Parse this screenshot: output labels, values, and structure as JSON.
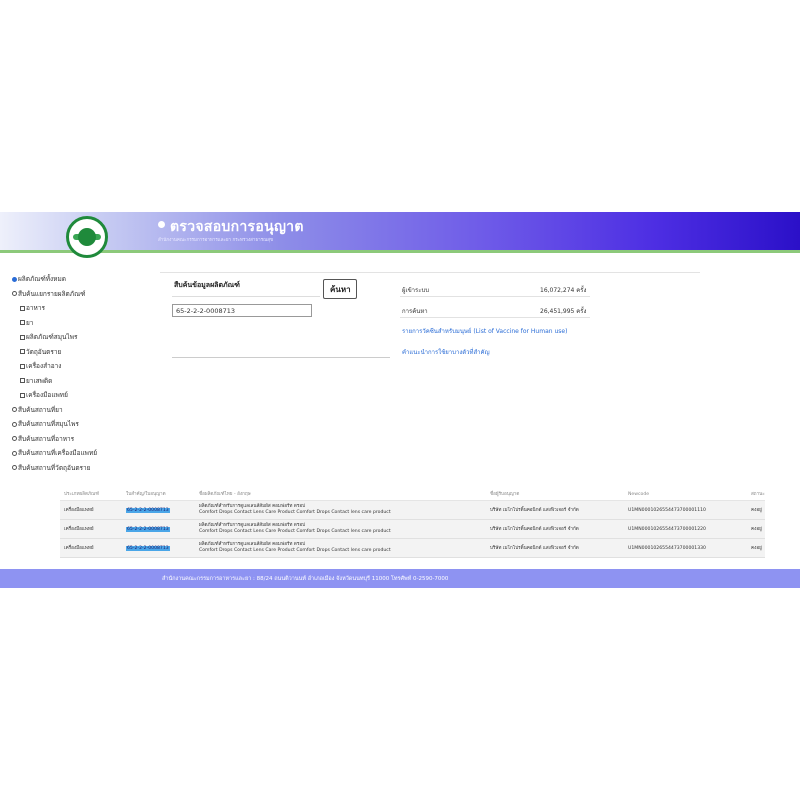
{
  "header": {
    "title": "ตรวจสอบการอนุญาต",
    "subtitle": "สำนักงานคณะกรรมการอาหารและยา กระทรวงสาธารณสุข"
  },
  "sidebar": {
    "items": [
      {
        "type": "radio",
        "checked": true,
        "label": "ผลิตภัณฑ์ทั้งหมด",
        "indent": false
      },
      {
        "type": "radio",
        "checked": false,
        "label": "สืบค้นแยกรายผลิตภัณฑ์",
        "indent": false
      },
      {
        "type": "checkbox",
        "checked": false,
        "label": "อาหาร",
        "indent": true
      },
      {
        "type": "checkbox",
        "checked": false,
        "label": "ยา",
        "indent": true
      },
      {
        "type": "checkbox",
        "checked": false,
        "label": "ผลิตภัณฑ์สมุนไพร",
        "indent": true
      },
      {
        "type": "checkbox",
        "checked": false,
        "label": "วัตถุอันตราย",
        "indent": true
      },
      {
        "type": "checkbox",
        "checked": false,
        "label": "เครื่องสำอาง",
        "indent": true
      },
      {
        "type": "checkbox",
        "checked": false,
        "label": "ยาเสพติด",
        "indent": true
      },
      {
        "type": "checkbox",
        "checked": false,
        "label": "เครื่องมือแพทย์",
        "indent": true
      },
      {
        "type": "radio",
        "checked": false,
        "label": "สืบค้นสถานที่ยา",
        "indent": false
      },
      {
        "type": "radio",
        "checked": false,
        "label": "สืบค้นสถานที่สมุนไพร",
        "indent": false
      },
      {
        "type": "radio",
        "checked": false,
        "label": "สืบค้นสถานที่อาหาร",
        "indent": false
      },
      {
        "type": "radio",
        "checked": false,
        "label": "สืบค้นสถานที่เครื่องมือแพทย์",
        "indent": false
      },
      {
        "type": "radio",
        "checked": false,
        "label": "สืบค้นสถานที่วัตถุอันตราย",
        "indent": false
      }
    ]
  },
  "search": {
    "label": "สืบค้นข้อมูลผลิตภัณฑ์",
    "button": "ค้นหา",
    "value": "65-2-2-2-0008713"
  },
  "stats": {
    "visitors_label": "ผู้เข้าระบบ",
    "visitors_value": "16,072,274 ครั้ง",
    "searches_label": "การค้นหา",
    "searches_value": "26,451,995 ครั้ง"
  },
  "links": {
    "vaccine": "รายการวัคซีนสำหรับมนุษย์ (List of Vaccine for Human use)",
    "essential": "คำแนะนำการใช้ยาบางตัวที่สำคัญ"
  },
  "table": {
    "headers": [
      "ประเภทผลิตภัณฑ์",
      "ใบสำคัญ/ใบอนุญาต",
      "ชื่อผลิตภัณฑ์ไทย - อังกฤษ",
      "ชื่อผู้รับอนุญาต",
      "Newcode",
      "สถานะ"
    ],
    "rows": [
      {
        "type": "เครื่องมือแพทย์",
        "license": "65-2-2-2-0008713",
        "name_th": "ผลิตภัณฑ์สำหรับการดูแลเลนส์สัมผัส คอมฟอร์ท ดรอป",
        "name_en": "Comfort Drops Contact Lens Care Product Comfort Drops Contact lens care product",
        "company": "บริษัท เมโกโปรดิ้นคอนิกด์ แสงฟิวเจอร์ จำกัด",
        "newcode": "U1MN0001026554473700001110",
        "status": "คงอยู่"
      },
      {
        "type": "เครื่องมือแพทย์",
        "license": "65-2-2-2-0008713",
        "name_th": "ผลิตภัณฑ์สำหรับการดูแลเลนส์สัมผัส คอมฟอร์ท ดรอป",
        "name_en": "Comfort Drops Contact Lens Care Product Comfort Drops Contact lens care product",
        "company": "บริษัท เมโกโปรดิ้นคอนิกด์ แสงฟิวเจอร์ จำกัด",
        "newcode": "U1MN0001026554473700001220",
        "status": "คงอยู่"
      },
      {
        "type": "เครื่องมือแพทย์",
        "license": "65-2-2-2-0008713",
        "name_th": "ผลิตภัณฑ์สำหรับการดูแลเลนส์สัมผัส คอมฟอร์ท ดรอป",
        "name_en": "Comfort Drops Contact Lens Care Product Comfort Drops Contact lens care product",
        "company": "บริษัท เมโกโปรดิ้นคอนิกด์ แสงฟิวเจอร์ จำกัด",
        "newcode": "U1MN0001026554473700001330",
        "status": "คงอยู่"
      }
    ]
  },
  "footer": {
    "text": "สำนักงานคณะกรรมการอาหารและยา : 88/24 ถนนติวานนท์ อำเภอเมือง จังหวัดนนทบุรี 11000 โทรศัพท์ 0-2590-7000"
  },
  "colors": {
    "banner_start": "#eef0fb",
    "banner_end": "#2b10c8",
    "footer": "#8e93f2",
    "link": "#2a6cd6",
    "highlight": "#4aa6e8"
  }
}
